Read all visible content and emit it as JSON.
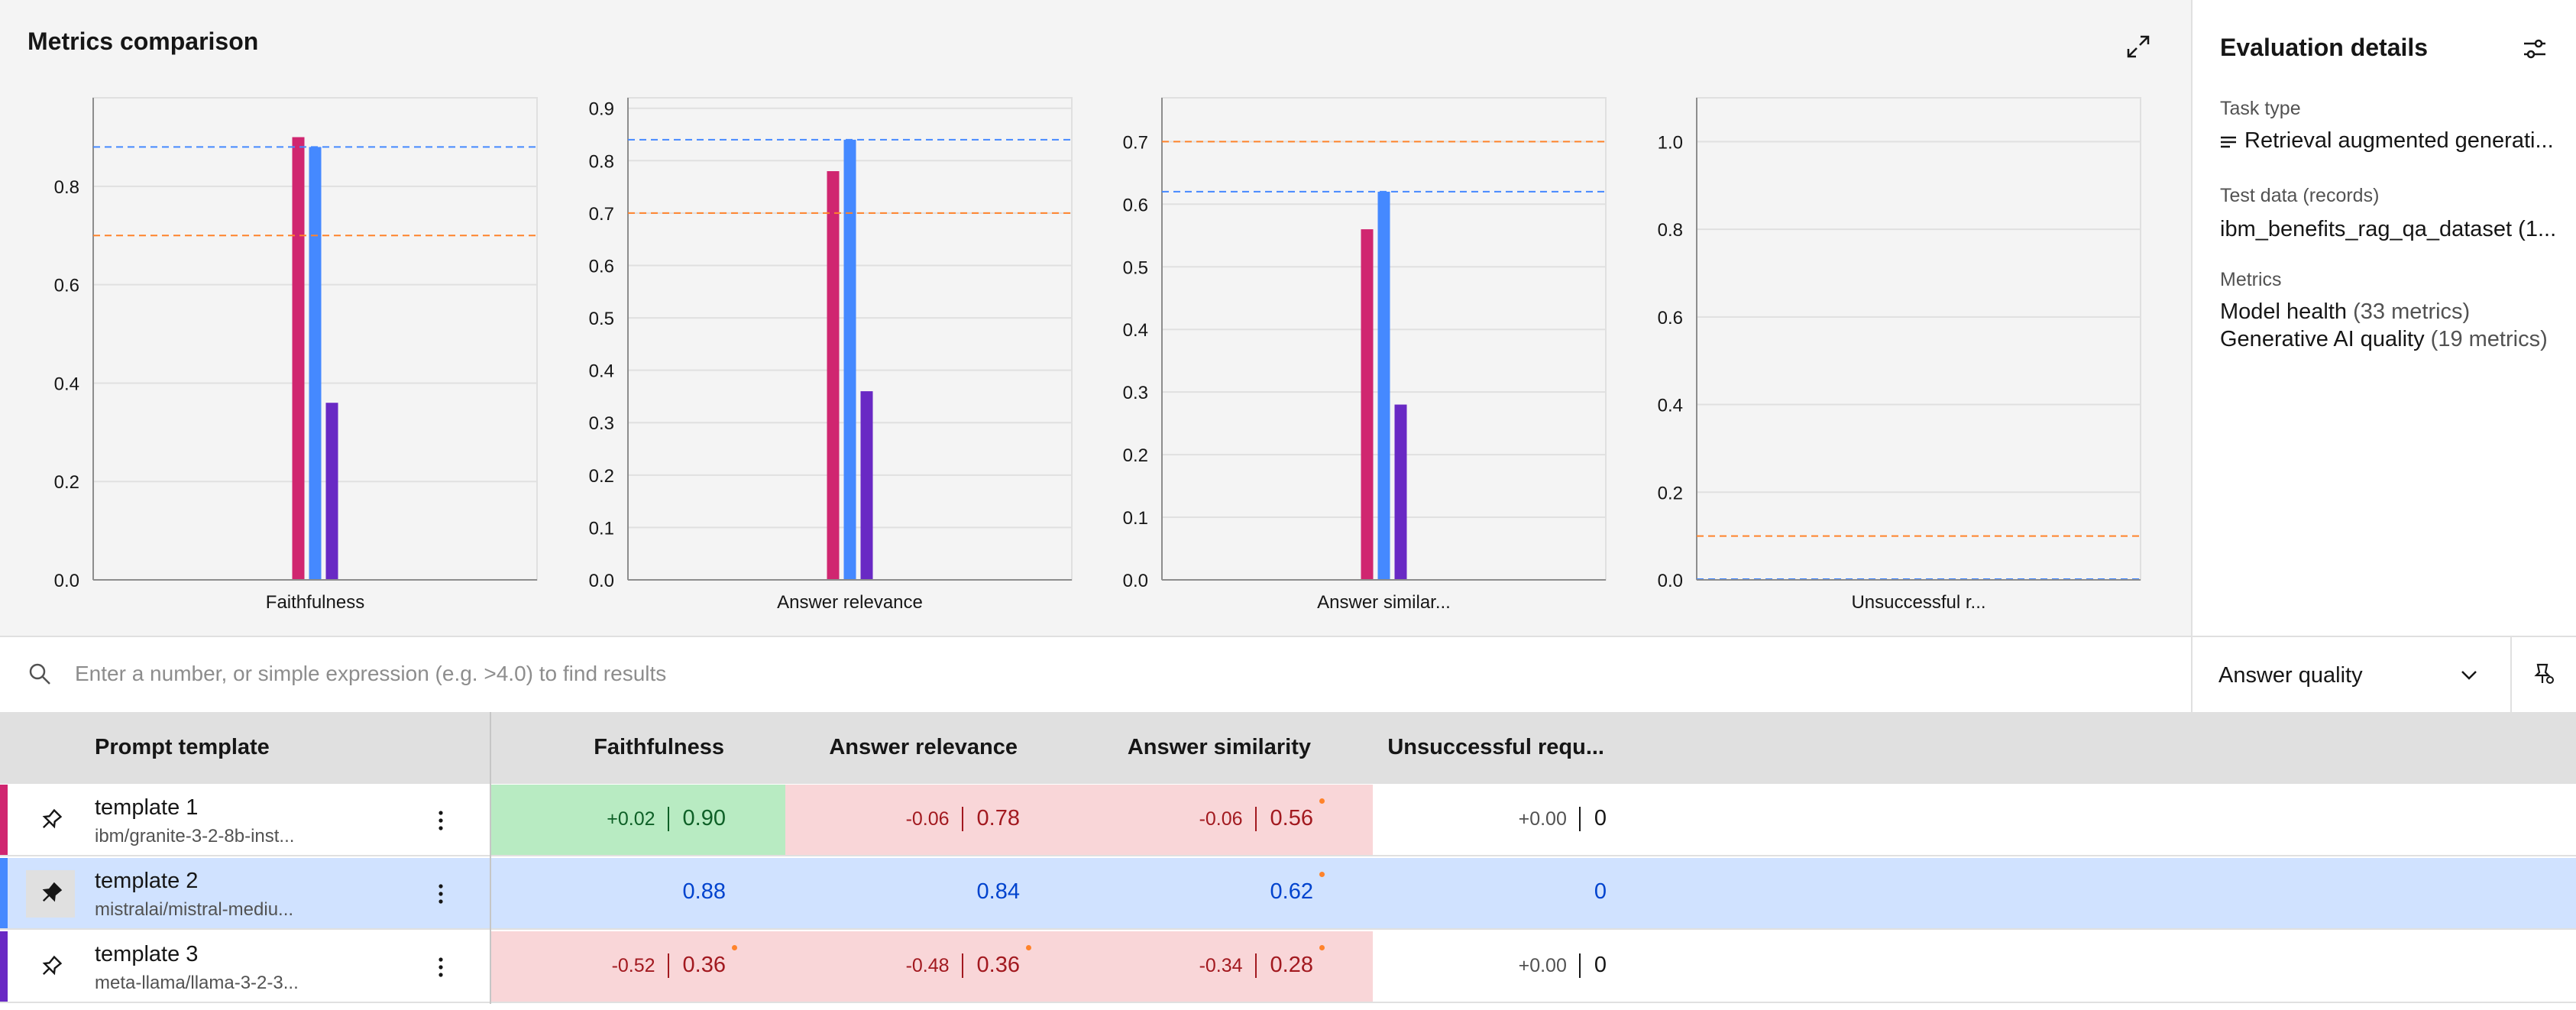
{
  "header": {
    "title": "Metrics comparison"
  },
  "details": {
    "title": "Evaluation details",
    "task_type_label": "Task type",
    "task_type_value": "Retrieval augmented generati...",
    "test_data_label": "Test data (records)",
    "test_data_value": "ibm_benefits_rag_qa_dataset (1...",
    "metrics_label": "Metrics",
    "metrics_line1": "Model health",
    "metrics_line1_count": "(33 metrics)",
    "metrics_line2": "Generative AI quality",
    "metrics_line2_count": "(19 metrics)"
  },
  "search": {
    "placeholder": "Enter a number, or simple expression (e.g. >4.0) to find results"
  },
  "dropdown": {
    "selected": "Answer quality"
  },
  "colors": {
    "template1": "#d02670",
    "template2": "#4589ff",
    "template3": "#6929c4",
    "better_bg": "#b8ebc2",
    "worse_bg": "#f9d6d8",
    "reference_bg": "#d0e2ff",
    "better_text": "#0e6027",
    "worse_text": "#a2191f",
    "reference_text": "#0043ce",
    "threshold": "#ff832b"
  },
  "table": {
    "columns": [
      "Prompt template",
      "Faithfulness",
      "Answer relevance",
      "Answer similarity",
      "Unsuccessful requ..."
    ],
    "rows": [
      {
        "name": "template 1",
        "model": "ibm/granite-3-2-8b-inst...",
        "pinned": false,
        "cells": [
          {
            "delta": "+0.02",
            "value": "0.90",
            "status": "better",
            "dot": false
          },
          {
            "delta": "-0.06",
            "value": "0.78",
            "status": "worse",
            "dot": false
          },
          {
            "delta": "-0.06",
            "value": "0.56",
            "status": "worse",
            "dot": true
          },
          {
            "delta": "+0.00",
            "value": "0",
            "status": "neutral",
            "dot": false
          }
        ]
      },
      {
        "name": "template 2",
        "model": "mistralai/mistral-mediu...",
        "pinned": true,
        "cells": [
          {
            "delta": "",
            "value": "0.88",
            "status": "reference",
            "dot": false
          },
          {
            "delta": "",
            "value": "0.84",
            "status": "reference",
            "dot": false
          },
          {
            "delta": "",
            "value": "0.62",
            "status": "reference",
            "dot": true
          },
          {
            "delta": "",
            "value": "0",
            "status": "reference",
            "dot": false
          }
        ]
      },
      {
        "name": "template 3",
        "model": "meta-llama/llama-3-2-3...",
        "pinned": false,
        "cells": [
          {
            "delta": "-0.52",
            "value": "0.36",
            "status": "worse",
            "dot": true
          },
          {
            "delta": "-0.48",
            "value": "0.36",
            "status": "worse",
            "dot": true
          },
          {
            "delta": "-0.34",
            "value": "0.28",
            "status": "worse",
            "dot": true
          },
          {
            "delta": "+0.00",
            "value": "0",
            "status": "neutral",
            "dot": false
          }
        ]
      }
    ]
  },
  "chart_data": [
    {
      "type": "bar",
      "categories": [
        "Faithfulness"
      ],
      "ylim": [
        0,
        0.98
      ],
      "yticks": [
        "0.0",
        "0.2",
        "0.4",
        "0.6",
        "0.8"
      ],
      "series": [
        {
          "values": [
            0.9
          ]
        },
        {
          "values": [
            0.88
          ]
        },
        {
          "values": [
            0.36
          ]
        }
      ],
      "reference_lines": [
        {
          "value": 0.88,
          "color": "#4589ff"
        },
        {
          "value": 0.7,
          "color": "#ff832b"
        }
      ],
      "grid": true
    },
    {
      "type": "bar",
      "categories": [
        "Answer relevance"
      ],
      "ylim": [
        0,
        0.92
      ],
      "yticks": [
        "0.0",
        "0.1",
        "0.2",
        "0.3",
        "0.4",
        "0.5",
        "0.6",
        "0.7",
        "0.8",
        "0.9"
      ],
      "series": [
        {
          "values": [
            0.78
          ]
        },
        {
          "values": [
            0.84
          ]
        },
        {
          "values": [
            0.36
          ]
        }
      ],
      "reference_lines": [
        {
          "value": 0.84,
          "color": "#4589ff"
        },
        {
          "value": 0.7,
          "color": "#ff832b"
        }
      ],
      "grid": true
    },
    {
      "type": "bar",
      "categories": [
        "Answer similar..."
      ],
      "ylim": [
        0,
        0.77
      ],
      "yticks": [
        "0.0",
        "0.1",
        "0.2",
        "0.3",
        "0.4",
        "0.5",
        "0.6",
        "0.7"
      ],
      "series": [
        {
          "values": [
            0.56
          ]
        },
        {
          "values": [
            0.62
          ]
        },
        {
          "values": [
            0.28
          ]
        }
      ],
      "reference_lines": [
        {
          "value": 0.62,
          "color": "#4589ff"
        },
        {
          "value": 0.7,
          "color": "#ff832b"
        }
      ],
      "grid": true
    },
    {
      "type": "bar",
      "categories": [
        "Unsuccessful r..."
      ],
      "ylim": [
        0,
        1.1
      ],
      "yticks": [
        "0.0",
        "0.2",
        "0.4",
        "0.6",
        "0.8",
        "1.0"
      ],
      "series": [
        {
          "values": [
            0
          ]
        },
        {
          "values": [
            0
          ]
        },
        {
          "values": [
            0
          ]
        }
      ],
      "reference_lines": [
        {
          "value": 0,
          "color": "#4589ff"
        },
        {
          "value": 0.1,
          "color": "#ff832b"
        }
      ],
      "grid": true
    }
  ]
}
